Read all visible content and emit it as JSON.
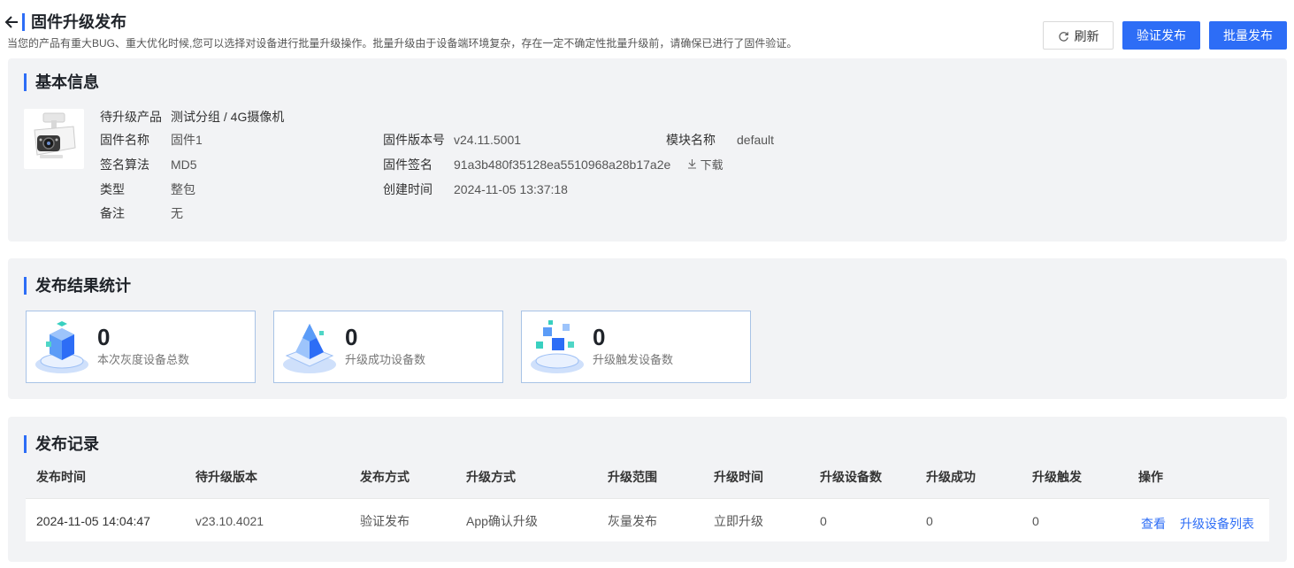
{
  "header": {
    "title": "固件升级发布",
    "description": "当您的产品有重大BUG、重大优化时候,您可以选择对设备进行批量升级操作。批量升级由于设备端环境复杂，存在一定不确定性批量升级前，请确保已进行了固件验证。",
    "refresh_label": "刷新",
    "verify_label": "验证发布",
    "batch_label": "批量发布"
  },
  "basic": {
    "title": "基本信息",
    "product_label": "待升级产品",
    "product_value": "测试分组 / 4G摄像机",
    "firmware_name_label": "固件名称",
    "firmware_name_value": "固件1",
    "firmware_version_label": "固件版本号",
    "firmware_version_value": "v24.11.5001",
    "module_label": "模块名称",
    "module_value": "default",
    "sign_algo_label": "签名算法",
    "sign_algo_value": "MD5",
    "signature_label": "固件签名",
    "signature_value": "91a3b480f35128ea5510968a28b17a2e",
    "download_label": "下载",
    "type_label": "类型",
    "type_value": "整包",
    "created_label": "创建时间",
    "created_value": "2024-11-05 13:37:18",
    "remark_label": "备注",
    "remark_value": "无"
  },
  "stats": {
    "title": "发布结果统计",
    "cards": [
      {
        "value": "0",
        "label": "本次灰度设备总数",
        "icon": "cube-stack-icon"
      },
      {
        "value": "0",
        "label": "升级成功设备数",
        "icon": "pyramid-icon"
      },
      {
        "value": "0",
        "label": "升级触发设备数",
        "icon": "scattered-cubes-icon"
      }
    ]
  },
  "records": {
    "title": "发布记录",
    "columns": [
      "发布时间",
      "待升级版本",
      "发布方式",
      "升级方式",
      "升级范围",
      "升级时间",
      "升级设备数",
      "升级成功",
      "升级触发",
      "操作"
    ],
    "rows": [
      {
        "publish_time": "2024-11-05 14:04:47",
        "version": "v23.10.4021",
        "publish_method": "验证发布",
        "upgrade_method": "App确认升级",
        "scope": "灰量发布",
        "upgrade_time": "立即升级",
        "device_count": "0",
        "success": "0",
        "triggered": "0",
        "action_view": "查看",
        "action_list": "升级设备列表"
      }
    ]
  },
  "colors": {
    "accent": "#2d6df6",
    "panel_bg": "#f2f3f5",
    "card_border": "#a8c3e6"
  }
}
